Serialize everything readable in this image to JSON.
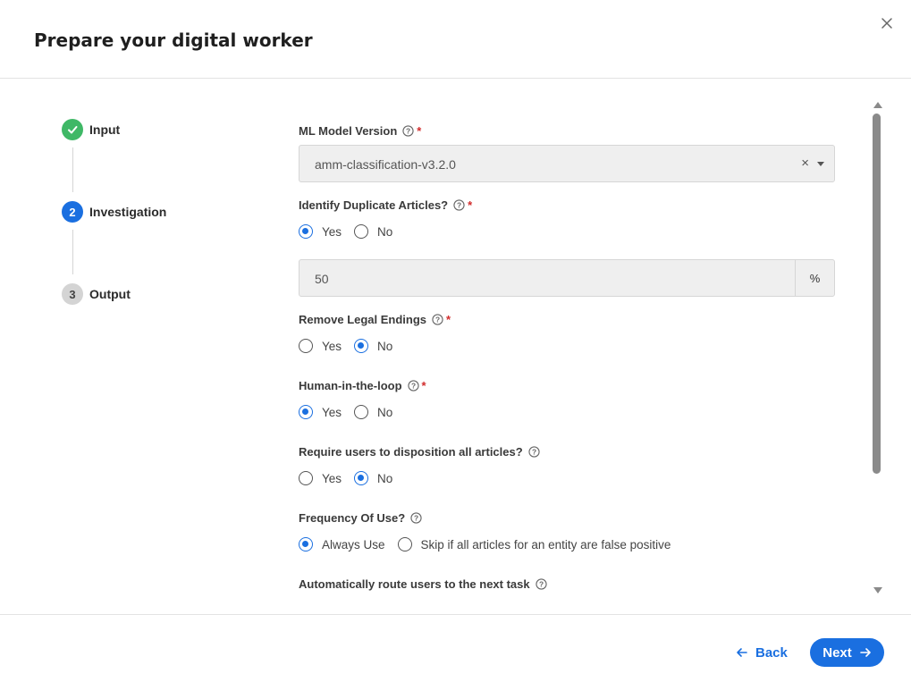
{
  "dialog": {
    "title": "Prepare your digital worker"
  },
  "steps": [
    {
      "number": "",
      "label": "Input",
      "status": "complete"
    },
    {
      "number": "2",
      "label": "Investigation",
      "status": "active"
    },
    {
      "number": "3",
      "label": "Output",
      "status": "pending"
    }
  ],
  "form": {
    "model_version": {
      "label": "ML Model Version",
      "required": "*",
      "value": "amm-classification-v3.2.0",
      "clear": "×"
    },
    "duplicates": {
      "label": "Identify Duplicate Articles?",
      "required": "*",
      "yes": "Yes",
      "no": "No",
      "selected": "Yes"
    },
    "threshold": {
      "value": "50",
      "unit": "%"
    },
    "legal_endings": {
      "label": "Remove Legal Endings",
      "required": "*",
      "yes": "Yes",
      "no": "No",
      "selected": "No"
    },
    "hitl": {
      "label": "Human-in-the-loop",
      "required": "*",
      "yes": "Yes",
      "no": "No",
      "selected": "Yes"
    },
    "disposition": {
      "label": "Require users to disposition all articles?",
      "yes": "Yes",
      "no": "No",
      "selected": "No"
    },
    "frequency": {
      "label": "Frequency Of Use?",
      "opt1": "Always Use",
      "opt2": "Skip if all articles for an entity are false positive",
      "selected": "Always Use"
    },
    "auto_route": {
      "label": "Automatically route users to the next task"
    }
  },
  "footer": {
    "back_label": "Back",
    "next_label": "Next"
  },
  "colors": {
    "accent": "#1a6fe0",
    "success": "#3fb866",
    "required": "#d12b2b"
  }
}
